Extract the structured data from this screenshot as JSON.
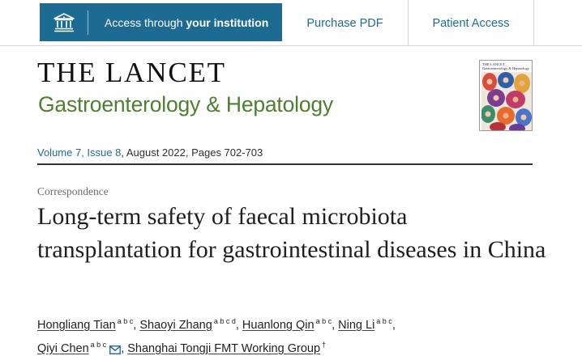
{
  "topbar": {
    "access": {
      "prefix": "Access through",
      "strong": "your institution"
    },
    "purchase_pdf": "Purchase PDF",
    "patient_access": "Patient Access"
  },
  "journal": {
    "title": "THE LANCET",
    "subtitle": "Gastroenterology & Hepatology",
    "cover_title": "THE LANCET",
    "cover_subtitle": "Gastroenterology & Hepatology"
  },
  "issue": {
    "volume_issue": "Volume 7, Issue 8",
    "rest": ", August 2022, Pages 702-703"
  },
  "article": {
    "type": "Correspondence",
    "title": "Long-term safety of faecal microbiota transplantation for gastrointestinal diseases in China"
  },
  "authors": [
    {
      "name": "Hongliang Tian",
      "sup": "a b c"
    },
    {
      "name": "Shaoyi Zhang",
      "sup": "a b c d"
    },
    {
      "name": "Huanlong Qin",
      "sup": "a b c"
    },
    {
      "name": "Ning Li",
      "sup": "a b c"
    },
    {
      "name": "Qiyi Chen",
      "sup": "a b c"
    },
    {
      "name": "Shanghai Tongji FMT Working Group",
      "sup": "†"
    }
  ],
  "colors": {
    "accent": "#1d6b93",
    "journal_green": "#4d7f2e",
    "rule": "#333333"
  },
  "icons": {
    "institution": "institution-icon",
    "mail": "mail-icon"
  }
}
